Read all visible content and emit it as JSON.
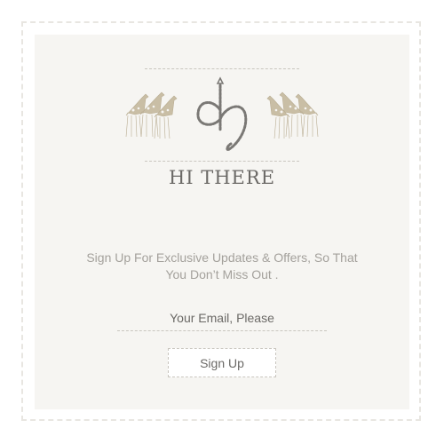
{
  "header": {
    "greeting": "HI THERE",
    "logo": "dh-monogram-logo",
    "decoration_icons": [
      "giraffe-herd-icon",
      "giraffe-herd-icon"
    ]
  },
  "main": {
    "tagline": "Sign Up For Exclusive Updates & Offers, So That You Don’t Miss Out ."
  },
  "form": {
    "email_value": "",
    "email_placeholder": "Your Email, Please",
    "signup_label": "Sign Up"
  },
  "colors": {
    "background": "#f6f5f2",
    "text": "#6b6966",
    "muted_text": "#a4a19c",
    "giraffe": "#c9bea5",
    "logo": "#7a7875"
  }
}
